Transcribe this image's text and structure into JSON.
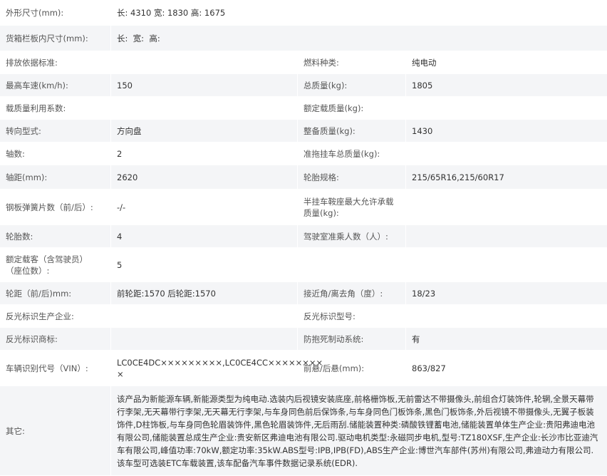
{
  "rows": [
    {
      "l1": "外形尺寸(mm):",
      "v1": "长: 4310 宽: 1830 高: 1675"
    },
    {
      "l1": "货箱栏板内尺寸(mm):",
      "v1": "长:  宽:  高:"
    },
    {
      "l1": "排放依据标准:",
      "v1": "",
      "l2": "燃料种类:",
      "v2": "纯电动"
    },
    {
      "l1": "最高车速(km/h):",
      "v1": "150",
      "l2": "总质量(kg):",
      "v2": "1805"
    },
    {
      "l1": "载质量利用系数:",
      "v1": "",
      "l2": "额定载质量(kg):",
      "v2": ""
    },
    {
      "l1": "转向型式:",
      "v1": "方向盘",
      "l2": "整备质量(kg):",
      "v2": "1430"
    },
    {
      "l1": "轴数:",
      "v1": "2",
      "l2": "准拖挂车总质量(kg):",
      "v2": ""
    },
    {
      "l1": "轴距(mm):",
      "v1": "2620",
      "l2": "轮胎规格:",
      "v2": "215/65R16,215/60R17"
    },
    {
      "l1": "钢板弹簧片数（前/后）:",
      "v1": "-/-",
      "l2": "半挂车鞍座最大允许承载\n质量(kg):",
      "v2": ""
    },
    {
      "l1": "轮胎数:",
      "v1": "4",
      "l2": "驾驶室准乘人数（人）:",
      "v2": ""
    },
    {
      "l1": "额定载客（含驾驶员）\n（座位数）:",
      "v1": "5"
    },
    {
      "l1": "轮距（前/后)mm:",
      "v1": "前轮距:1570 后轮距:1570",
      "l2": "接近角/离去角（度）:",
      "v2": "18/23"
    },
    {
      "l1": "反光标识生产企业:",
      "v1": "",
      "l2": "反光标识型号:",
      "v2": ""
    },
    {
      "l1": "反光标识商标:",
      "v1": "",
      "l2": "防抱死制动系统:",
      "v2": "有"
    },
    {
      "l1": "车辆识别代号（VIN）:",
      "v1": "LC0CE4DC×××××××××,LC0CE4CC××××××××\n×",
      "l2": "前悬/后悬(mm):",
      "v2": "863/827"
    },
    {
      "l1": "其它:",
      "v1": "该产品为新能源车辆,新能源类型为纯电动.选装内后视镜安装底座,前格栅饰板,无前雷达不带摄像头,前组合灯装饰件,轮辋,全景天幕带行李架,无天幕带行李架,无天幕无行李架,与车身同色前后保饰条,与车身同色门板饰条,黑色门板饰条,外后视镜不带摄像头,无翼子板装饰件,D柱饰板,与车身同色轮眉装饰件,黑色轮眉装饰件,无后雨刮.储能装置种类:磷酸铁锂蓄电池,储能装置单体生产企业:贵阳弗迪电池有限公司,储能装置总成生产企业:贵安新区弗迪电池有限公司.驱动电机类型:永磁同步电机,型号:TZ180XSF,生产企业:长沙市比亚迪汽车有限公司,峰值功率:70kW,额定功率:35kW.ABS型号:IPB,IPB(FD),ABS生产企业:博世汽车部件(苏州)有限公司,弗迪动力有限公司.该车型可选装ETC车载装置,该车配备汽车事件数据记录系统(EDR)."
    }
  ]
}
